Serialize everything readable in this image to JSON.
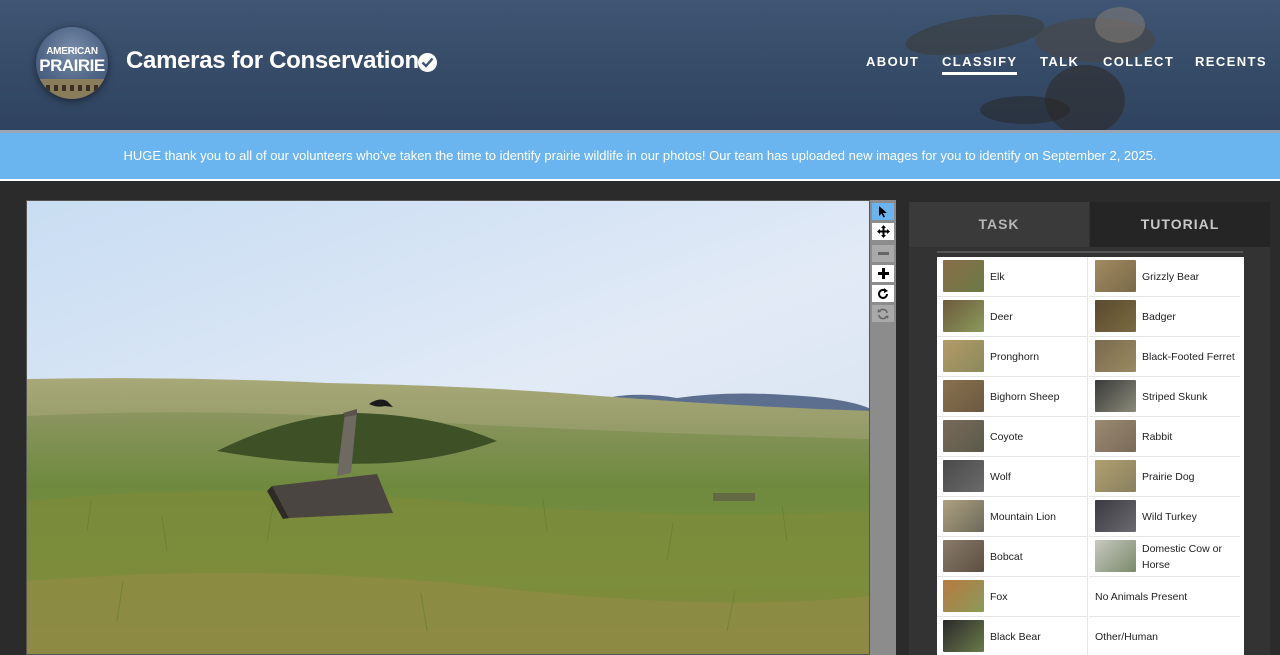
{
  "header": {
    "logo": {
      "line1": "AMERICAN",
      "line2": "PRAIRIE"
    },
    "title": "Cameras for Conservation",
    "verified_icon": "check-circle-icon",
    "nav": [
      {
        "label": "ABOUT",
        "active": false
      },
      {
        "label": "CLASSIFY",
        "active": true
      },
      {
        "label": "TALK",
        "active": false
      },
      {
        "label": "COLLECT",
        "active": false
      },
      {
        "label": "RECENTS",
        "active": false
      }
    ]
  },
  "announcement": {
    "text": "HUGE thank you to all of our volunteers who've taken the time to identify prairie wildlife in our photos! Our team has uploaded new images for you to identify on September 2, 2025."
  },
  "toolbar": {
    "tools": [
      {
        "icon": "pointer-icon",
        "active": true
      },
      {
        "icon": "move-icon",
        "active": false
      },
      {
        "icon": "zoom-out-icon",
        "disabled": true
      },
      {
        "icon": "zoom-in-icon",
        "active": false
      },
      {
        "icon": "rotate-icon",
        "active": false
      },
      {
        "icon": "reset-icon",
        "disabled": true
      }
    ]
  },
  "panel": {
    "tabs": [
      {
        "label": "TASK",
        "active": true
      },
      {
        "label": "TUTORIAL",
        "active": false
      }
    ],
    "choices": [
      {
        "label": "Elk",
        "thumb": true
      },
      {
        "label": "Grizzly Bear",
        "thumb": true
      },
      {
        "label": "Deer",
        "thumb": true
      },
      {
        "label": "Badger",
        "thumb": true
      },
      {
        "label": "Pronghorn",
        "thumb": true
      },
      {
        "label": "Black-Footed Ferret",
        "thumb": true
      },
      {
        "label": "Bighorn Sheep",
        "thumb": true
      },
      {
        "label": "Striped Skunk",
        "thumb": true
      },
      {
        "label": "Coyote",
        "thumb": true
      },
      {
        "label": "Rabbit",
        "thumb": true
      },
      {
        "label": "Wolf",
        "thumb": true
      },
      {
        "label": "Prairie Dog",
        "thumb": true
      },
      {
        "label": "Mountain Lion",
        "thumb": true
      },
      {
        "label": "Wild Turkey",
        "thumb": true
      },
      {
        "label": "Bobcat",
        "thumb": true
      },
      {
        "label": "Domestic Cow or Horse",
        "thumb": true
      },
      {
        "label": "Fox",
        "thumb": true
      },
      {
        "label": "No Animals Present",
        "thumb": false
      },
      {
        "label": "Black Bear",
        "thumb": true
      },
      {
        "label": "Other/Human",
        "thumb": false
      }
    ]
  },
  "colors": {
    "accent": "#6ab4f0",
    "header_bg": "#3f5573",
    "page_bg": "#2b2b2b"
  }
}
